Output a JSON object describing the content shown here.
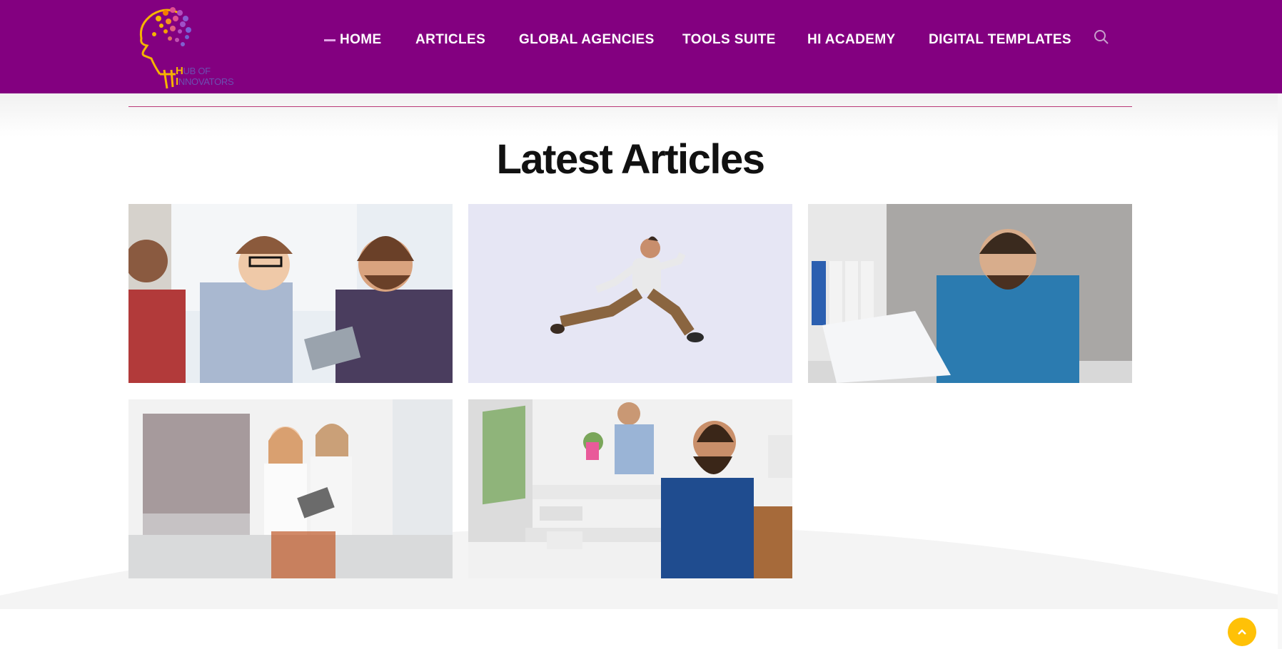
{
  "header": {
    "logo": {
      "line1_cap": "H",
      "line1_rest": "UB OF",
      "line2_cap": "I",
      "line2_rest": "NNOVATORS"
    },
    "nav": [
      {
        "label": "HOME",
        "active": true
      },
      {
        "label": "ARTICLES"
      },
      {
        "label": "GLOBAL AGENCIES"
      },
      {
        "label": "TOOLS SUITE"
      },
      {
        "label": "HI ACADEMY"
      },
      {
        "label": "DIGITAL TEMPLATES"
      }
    ],
    "search_icon": "search-icon"
  },
  "main": {
    "title": "Latest Articles",
    "articles": [
      {
        "image": "team-meeting-photo"
      },
      {
        "image": "jumping-man-photo"
      },
      {
        "image": "man-laptop-photo"
      },
      {
        "image": "women-tablet-photo"
      },
      {
        "image": "office-desks-photo"
      }
    ]
  },
  "scroll_top_icon": "chevron-up-icon",
  "colors": {
    "header_bg": "#830080",
    "accent": "#ffc107",
    "divider": "#b93a78"
  }
}
